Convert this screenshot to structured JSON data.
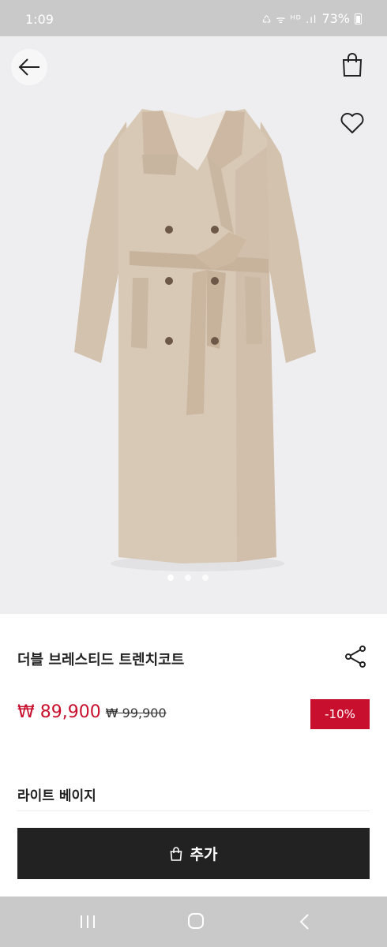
{
  "status_bar": {
    "time": "1:09",
    "icons": "♺ ᯤ ᴴᴰ .ıl",
    "battery": "73%"
  },
  "gallery": {
    "pager_count": 3,
    "active_index": 0,
    "coat_color": "#d6c6b4"
  },
  "product": {
    "title": "더블 브레스티드 트렌치코트",
    "sale_price": "₩ 89,900",
    "original_price": "₩ 99,900",
    "discount": "-10%",
    "color_name": "라이트 베이지"
  },
  "cta": {
    "add_label": "추가"
  },
  "colors": {
    "accent": "#c8102e",
    "button": "#222222"
  }
}
